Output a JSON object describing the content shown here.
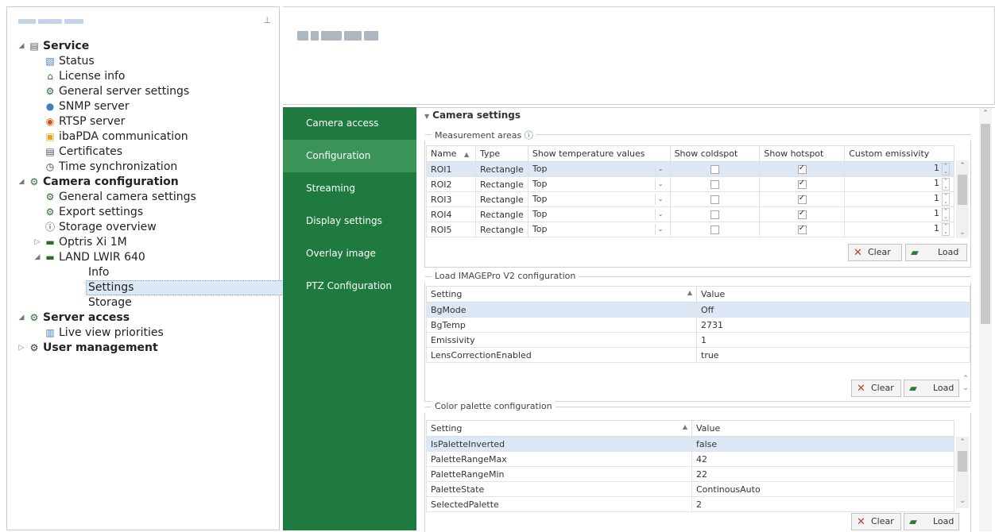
{
  "tree": {
    "items": [
      {
        "label": "Service",
        "bold": true,
        "level": 0,
        "expander": "◢",
        "icon": "server-icon"
      },
      {
        "label": "Status",
        "level": 1,
        "icon": "status-icon"
      },
      {
        "label": "License info",
        "level": 1,
        "icon": "license-icon"
      },
      {
        "label": "General server settings",
        "level": 1,
        "icon": "gears-icon"
      },
      {
        "label": "SNMP server",
        "level": 1,
        "icon": "snmp-icon"
      },
      {
        "label": "RTSP server",
        "level": 1,
        "icon": "rtsp-icon"
      },
      {
        "label": "ibaPDA communication",
        "level": 1,
        "icon": "pda-icon"
      },
      {
        "label": "Certificates",
        "level": 1,
        "icon": "certificate-icon"
      },
      {
        "label": "Time synchronization",
        "level": 1,
        "icon": "clock-icon"
      },
      {
        "label": "Camera configuration",
        "bold": true,
        "level": 0,
        "expander": "◢",
        "icon": "gears-icon"
      },
      {
        "label": "General camera settings",
        "level": 1,
        "icon": "gears-icon"
      },
      {
        "label": "Export settings",
        "level": 1,
        "icon": "gears-icon"
      },
      {
        "label": "Storage overview",
        "level": 1,
        "icon": "info-icon"
      },
      {
        "label": "Optris Xi 1M",
        "level": 1,
        "expander": "▷",
        "icon": "camera-icon"
      },
      {
        "label": "LAND LWIR 640",
        "level": 1,
        "expander": "◢",
        "icon": "camera-icon"
      },
      {
        "label": "Info",
        "level": 2
      },
      {
        "label": "Settings",
        "level": 2,
        "selected": true
      },
      {
        "label": "Storage",
        "level": 2
      },
      {
        "label": "Server access",
        "bold": true,
        "level": 0,
        "expander": "◢",
        "icon": "gears-icon"
      },
      {
        "label": "Live view priorities",
        "level": 1,
        "icon": "priorities-icon"
      },
      {
        "label": "User management",
        "bold": true,
        "level": 0,
        "expander": "▷",
        "icon": "user-gear-icon"
      }
    ]
  },
  "nav": {
    "items": [
      {
        "label": "Camera access"
      },
      {
        "label": "Configuration",
        "active": true
      },
      {
        "label": "Streaming"
      },
      {
        "label": "Display settings"
      },
      {
        "label": "Overlay image"
      },
      {
        "label": "PTZ Configuration"
      }
    ]
  },
  "camera_settings": {
    "title": "Camera settings",
    "measurement": {
      "label": "Measurement areas",
      "columns": [
        "Name",
        "Type",
        "Show temperature values",
        "Show coldspot",
        "Show hotspot",
        "Custom emissivity"
      ],
      "rows": [
        {
          "name": "ROI1",
          "type": "Rectangle",
          "temp": "Top",
          "cold": false,
          "hot": true,
          "emis": "1"
        },
        {
          "name": "ROI2",
          "type": "Rectangle",
          "temp": "Top",
          "cold": false,
          "hot": true,
          "emis": "1"
        },
        {
          "name": "ROI3",
          "type": "Rectangle",
          "temp": "Top",
          "cold": false,
          "hot": true,
          "emis": "1"
        },
        {
          "name": "ROI4",
          "type": "Rectangle",
          "temp": "Top",
          "cold": false,
          "hot": true,
          "emis": "1"
        },
        {
          "name": "ROI5",
          "type": "Rectangle",
          "temp": "Top",
          "cold": false,
          "hot": true,
          "emis": "1"
        }
      ],
      "clear_label": "Clear",
      "load_label": "Load"
    },
    "imagepro": {
      "label": "Load IMAGEPro V2 configuration",
      "columns": [
        "Setting",
        "Value"
      ],
      "rows": [
        {
          "setting": "BgMode",
          "value": "Off"
        },
        {
          "setting": "BgTemp",
          "value": "2731"
        },
        {
          "setting": "Emissivity",
          "value": "1"
        },
        {
          "setting": "LensCorrectionEnabled",
          "value": "true"
        }
      ],
      "clear_label": "Clear",
      "load_label": "Load"
    },
    "palette": {
      "label": "Color palette configuration",
      "columns": [
        "Setting",
        "Value"
      ],
      "rows": [
        {
          "setting": "IsPaletteInverted",
          "value": "false"
        },
        {
          "setting": "PaletteRangeMax",
          "value": "42"
        },
        {
          "setting": "PaletteRangeMin",
          "value": "22"
        },
        {
          "setting": "PaletteState",
          "value": "ContinousAuto"
        },
        {
          "setting": "SelectedPalette",
          "value": "2"
        }
      ],
      "clear_label": "Clear",
      "load_label": "Load"
    }
  },
  "colors": {
    "nav_green": "#1e7a3e",
    "nav_active": "#3a9457",
    "selection": "#dde8f6"
  }
}
